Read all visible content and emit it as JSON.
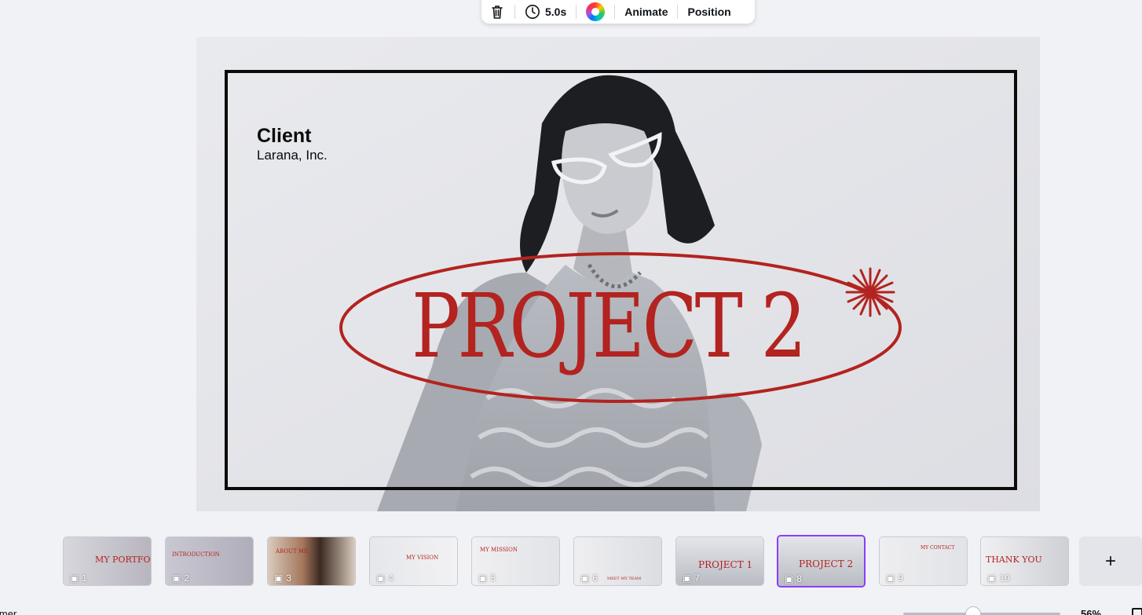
{
  "toolbar": {
    "delete_icon": "trash-icon",
    "duration": "5.0s",
    "duration_icon": "clock-icon",
    "color_icon": "color-wheel-icon",
    "animate_label": "Animate",
    "position_label": "Position"
  },
  "slide": {
    "client_label": "Client",
    "client_name": "Larana, Inc.",
    "title": "PROJECT 2",
    "accent_color": "#b3231f",
    "frame_color": "#0b0b0b"
  },
  "thumbnails": [
    {
      "number": "1",
      "caption": "MY PORTFOLIO"
    },
    {
      "number": "2",
      "caption": "INTRODUCTION"
    },
    {
      "number": "3",
      "caption": "ABOUT ME"
    },
    {
      "number": "4",
      "caption": "MY VISION"
    },
    {
      "number": "5",
      "caption": "MY MISSION"
    },
    {
      "number": "6",
      "caption": "MEET MY TEAM"
    },
    {
      "number": "7",
      "caption": "PROJECT 1"
    },
    {
      "number": "8",
      "caption": "PROJECT 2"
    },
    {
      "number": "9",
      "caption": "MY CONTACT"
    },
    {
      "number": "10",
      "caption": "THANK YOU"
    }
  ],
  "active_thumbnail": "8",
  "add_page_label": "+",
  "footer": {
    "timer_label": "imer",
    "zoom": "56%"
  },
  "colors": {
    "accent_purple": "#8b3dff",
    "background": "#f1f2f6"
  }
}
